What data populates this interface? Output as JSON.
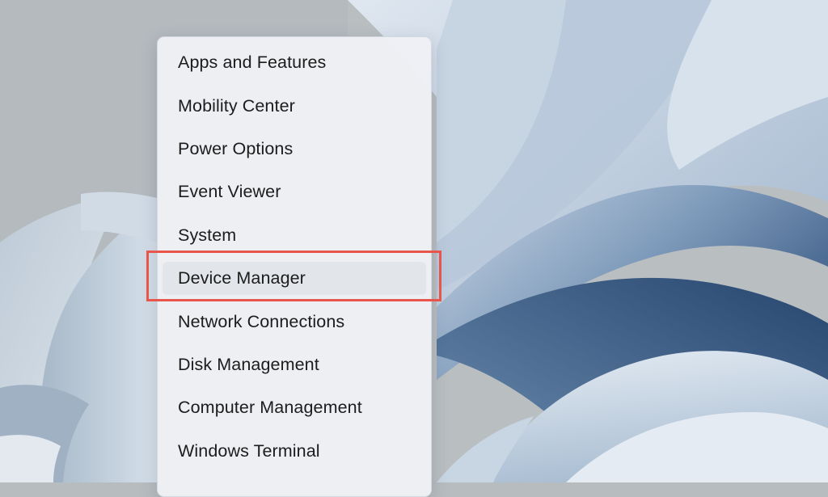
{
  "context_menu": {
    "items": [
      {
        "label": "Apps and Features",
        "name": "menu-item-apps-and-features"
      },
      {
        "label": "Mobility Center",
        "name": "menu-item-mobility-center"
      },
      {
        "label": "Power Options",
        "name": "menu-item-power-options"
      },
      {
        "label": "Event Viewer",
        "name": "menu-item-event-viewer"
      },
      {
        "label": "System",
        "name": "menu-item-system"
      },
      {
        "label": "Device Manager",
        "name": "menu-item-device-manager"
      },
      {
        "label": "Network Connections",
        "name": "menu-item-network-connections"
      },
      {
        "label": "Disk Management",
        "name": "menu-item-disk-management"
      },
      {
        "label": "Computer Management",
        "name": "menu-item-computer-management"
      },
      {
        "label": "Windows Terminal",
        "name": "menu-item-windows-terminal"
      }
    ],
    "highlighted_item": "Device Manager"
  },
  "annotation": {
    "highlight_color": "#e8554a"
  },
  "colors": {
    "menu_background": "#eff1f5",
    "wallpaper_base": "#b7bcbf",
    "wallpaper_blue": "#6f8fb3"
  }
}
